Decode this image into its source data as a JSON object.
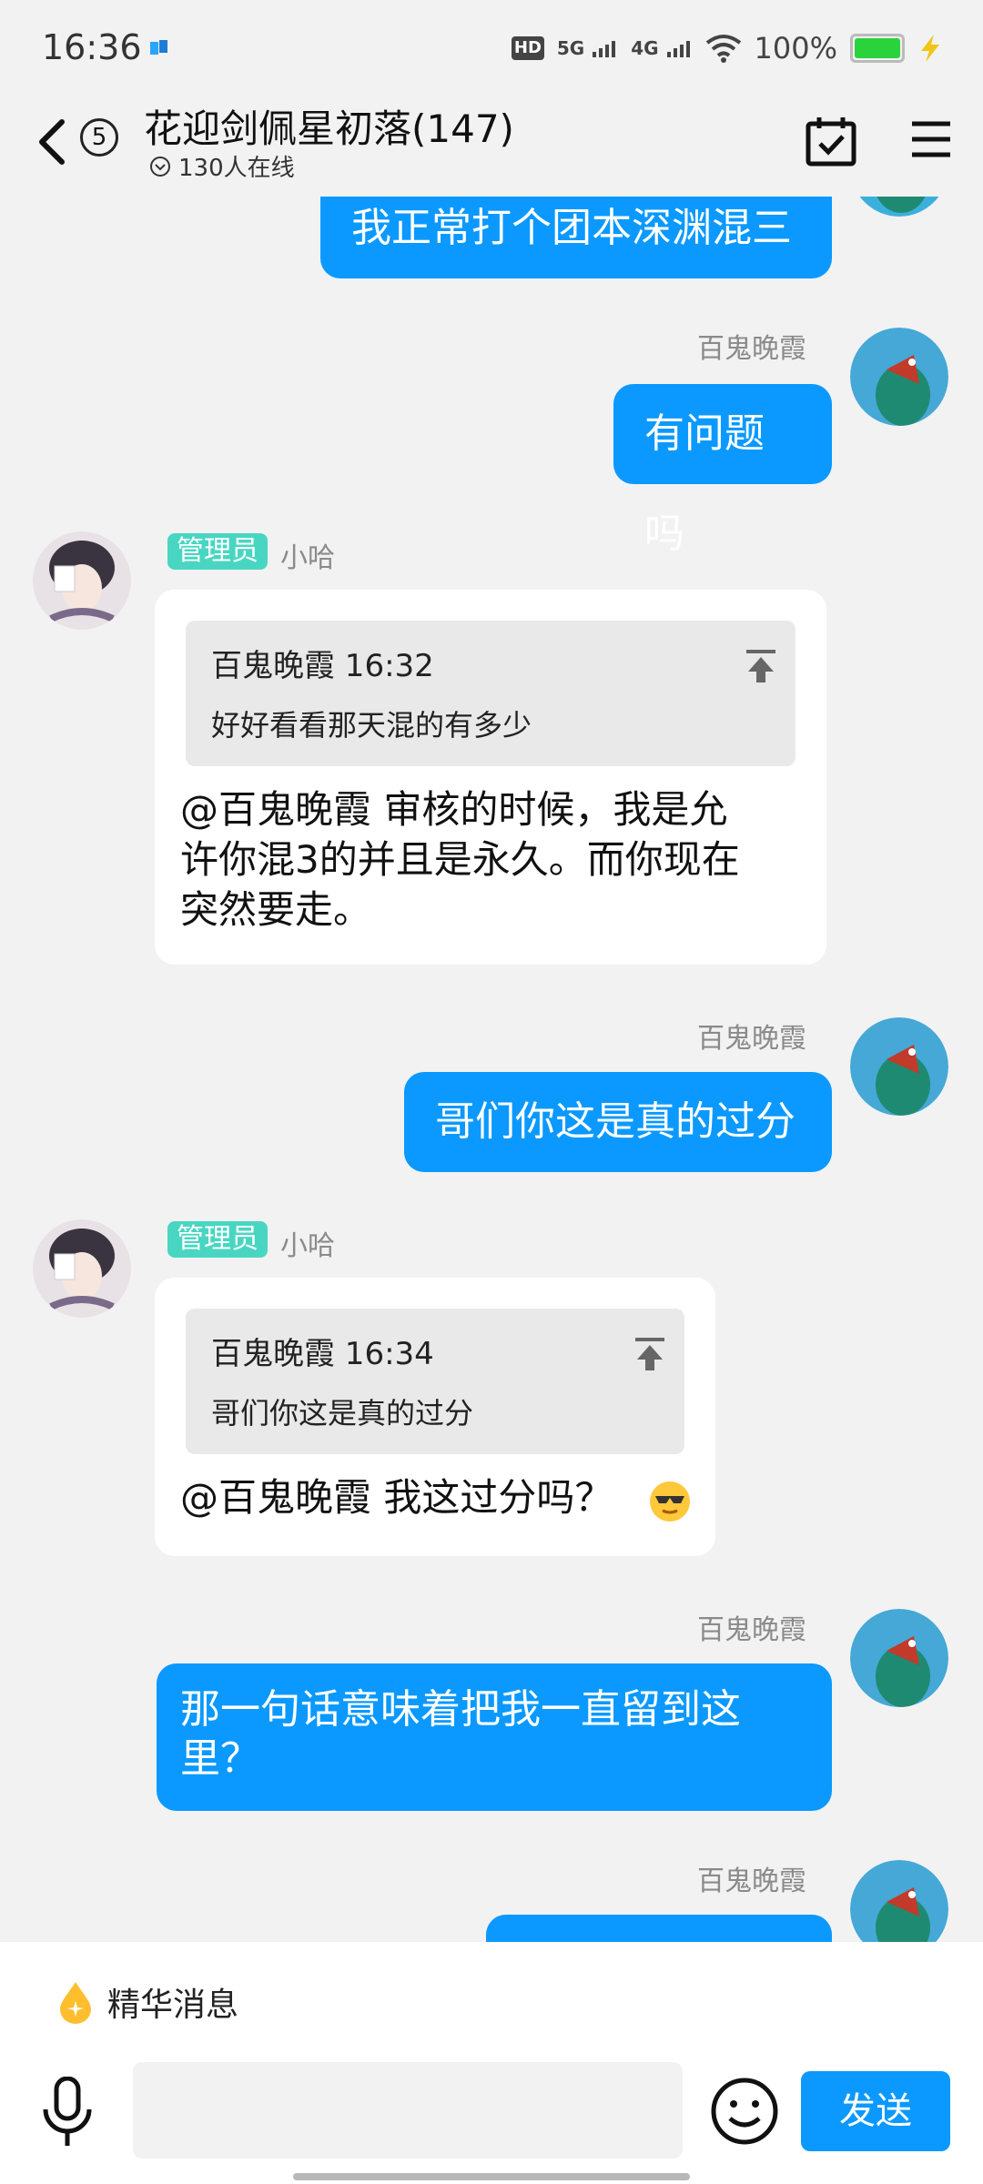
{
  "status_bar": {
    "time": "16:36",
    "network_hd": "HD",
    "network_5g": "5G",
    "network_4g": "4G",
    "battery_percent": "100%",
    "battery_color": "#2ad33c"
  },
  "header": {
    "unread_count": "5",
    "title": "花迎剑佩星初落(147)",
    "online_text": "130人在线"
  },
  "messages": [
    {
      "side": "out",
      "text": "我正常打个团本深渊混三"
    },
    {
      "side": "out",
      "sender": "百鬼晚霞",
      "text": "有问题吗"
    },
    {
      "side": "in",
      "role": "管理员",
      "sender": "小哈",
      "quote_head": "百鬼晚霞 16:32",
      "quote_body": "好好看看那天混的有多少",
      "line1": "@百鬼晚霞 审核的时候，我是允",
      "line2": "许你混3的并且是永久。而你现在",
      "line3": "突然要走。"
    },
    {
      "side": "out",
      "sender": "百鬼晚霞",
      "text": "哥们你这是真的过分"
    },
    {
      "side": "in",
      "role": "管理员",
      "sender": "小哈",
      "quote_head": "百鬼晚霞 16:34",
      "quote_body": "哥们你这是真的过分",
      "line1": "@百鬼晚霞 我这过分吗？"
    },
    {
      "side": "out",
      "sender": "百鬼晚霞",
      "line1": "那一句话意味着把我一直留到这",
      "line2": "里？"
    },
    {
      "side": "out",
      "sender": "百鬼晚霞",
      "text": ""
    }
  ],
  "bottom": {
    "featured_label": "精华消息",
    "input_placeholder": "",
    "send_label": "发送"
  },
  "colors": {
    "accent": "#0b99ff",
    "role_badge": "#48d6c2"
  },
  "icons": [
    "back-icon",
    "calendar-check-icon",
    "menu-icon",
    "chevron-circle-icon",
    "pin-top-icon",
    "drop-star-icon",
    "mic-icon",
    "emoji-icon",
    "cool-face-emoji"
  ]
}
